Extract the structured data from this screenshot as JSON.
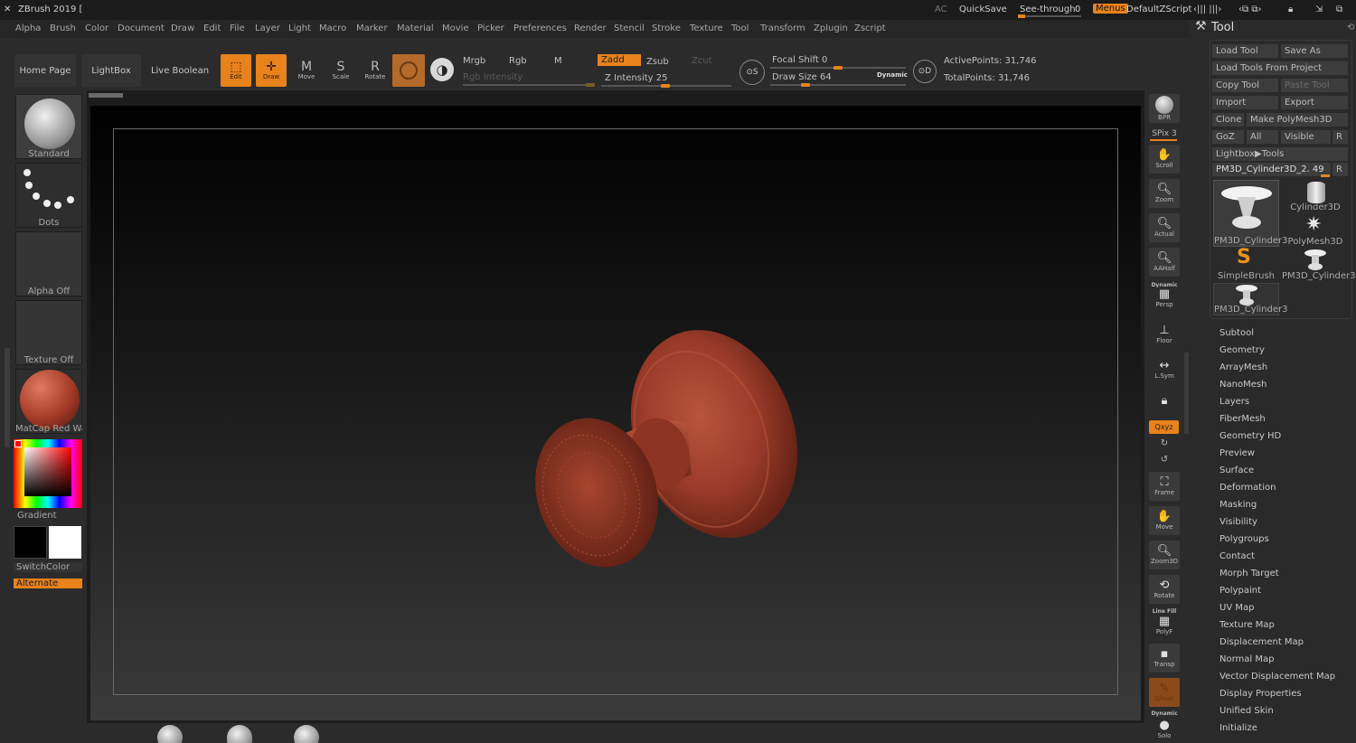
{
  "app": {
    "title": "ZBrush 2019 [",
    "ac": "AC",
    "quicksave": "QuickSave",
    "see_through_label": "See-through",
    "see_through_value": "0",
    "menus": "Menus",
    "default_zscript": "DefaultZScript"
  },
  "menu": [
    "Alpha",
    "Brush",
    "Color",
    "Document",
    "Draw",
    "Edit",
    "File",
    "Layer",
    "Light",
    "Macro",
    "Marker",
    "Material",
    "Movie",
    "Picker",
    "Preferences",
    "Render",
    "Stencil",
    "Stroke",
    "Texture",
    "Tool",
    "Transform",
    "Zplugin",
    "Zscript"
  ],
  "toolbar": {
    "home_page": "Home Page",
    "lightbox": "LightBox",
    "live_boolean": "Live Boolean",
    "edit": "Edit",
    "draw": "Draw",
    "move": "Move",
    "scale": "Scale",
    "rotate": "Rotate",
    "mrgb": "Mrgb",
    "rgb": "Rgb",
    "m": "M",
    "zadd": "Zadd",
    "zsub": "Zsub",
    "zcut": "Zcut",
    "rgb_intensity": "Rgb Intensity",
    "z_intensity": "Z Intensity 25",
    "focal_shift": "Focal Shift 0",
    "draw_size": "Draw Size 64",
    "dynamic": "Dynamic",
    "active_points": "ActivePoints: 31,746",
    "total_points": "TotalPoints: 31,746"
  },
  "left_shelf": {
    "brush": "Standard",
    "stroke": "Dots",
    "alpha": "Alpha Off",
    "texture": "Texture Off",
    "material": "MatCap Red Wax",
    "gradient": "Gradient",
    "switch_color": "SwitchColor",
    "alternate": "Alternate"
  },
  "right_dock": {
    "bpr": "BPR",
    "spix": "SPix 3",
    "scroll": "Scroll",
    "zoom": "Zoom",
    "actual": "Actual",
    "aahalf": "AAHalf",
    "dynamic": "Dynamic",
    "persp": "Persp",
    "floor": "Floor",
    "lsym": "L.Sym",
    "xyz": "Qxyz",
    "frame": "Frame",
    "move": "Move",
    "zoom3d": "Zoom3D",
    "rotate": "Rotate",
    "line_fill": "Line Fill",
    "polyf": "PolyF",
    "transp": "Transp",
    "ghost": "Ghost",
    "dynamic2": "Dynamic",
    "solo": "Solo"
  },
  "tool": {
    "title": "Tool",
    "buttons": {
      "load_tool": "Load Tool",
      "save_as": "Save As",
      "load_from_project": "Load Tools From Project",
      "copy_tool": "Copy Tool",
      "paste_tool": "Paste Tool",
      "import": "Import",
      "export": "Export",
      "clone": "Clone",
      "make_polymesh": "Make PolyMesh3D",
      "goz": "GoZ",
      "all": "All",
      "visible": "Visible",
      "r": "R",
      "lightbox_tools": "Lightbox▶Tools",
      "current": "PM3D_Cylinder3D_2. 49"
    },
    "thumbs": [
      "PM3D_Cylinder3",
      "Cylinder3D",
      "PolyMesh3D",
      "SimpleBrush",
      "PM3D_Cylinder3",
      "PM3D_Cylinder3"
    ],
    "sections": [
      "Subtool",
      "Geometry",
      "ArrayMesh",
      "NanoMesh",
      "Layers",
      "FiberMesh",
      "Geometry HD",
      "Preview",
      "Surface",
      "Deformation",
      "Masking",
      "Visibility",
      "Polygroups",
      "Contact",
      "Morph Target",
      "Polypaint",
      "UV Map",
      "Texture Map",
      "Displacement Map",
      "Normal Map",
      "Vector Displacement Map",
      "Display Properties",
      "Unified Skin",
      "Initialize"
    ]
  },
  "colors": {
    "accent": "#e8821b",
    "model": "#9a3b2a"
  }
}
